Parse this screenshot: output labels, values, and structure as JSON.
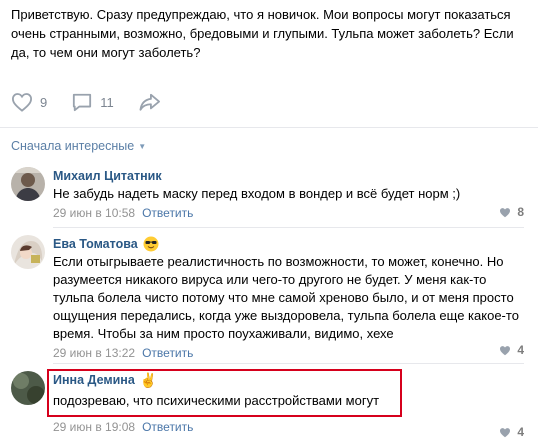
{
  "post": {
    "text": "Приветствую. Сразу предупреждаю, что я новичок. Мои вопросы могут показаться очень странными, возможно, бредовыми и глупыми. Тульпа может заболеть? Если да, то чем они могут заболеть?",
    "likes": "9",
    "comments": "11"
  },
  "sort_label": "Сначала интересные",
  "comments": [
    {
      "author": "Михаил Цитатник",
      "text": "Не забудь надеть маску перед входом в вондер и всё будет норм ;)",
      "date": "29 июн в 10:58",
      "reply": "Ответить",
      "likes": "8"
    },
    {
      "author": "Ева Томатова",
      "emoji": "smiling-face-with-sunglasses-icon",
      "text": "Если отыгрываете реалистичность по возможности, то может, конечно. Но разумеется никакого вируса или чего-то другого не будет. У меня как-то тульпа болела чисто потому что мне самой хреново было, и от меня просто ощущения передались, когда уже выздоровела, тульпа болела еще какое-то время. Чтобы за ним просто поухаживали, видимо, хехе",
      "date": "29 июн в 13:22",
      "reply": "Ответить",
      "likes": "4"
    },
    {
      "author": "Инна Демина",
      "emoji": "victory-hand-icon",
      "text": "подозреваю, что психическими расстройствами могут",
      "date": "29 июн в 19:08",
      "reply": "Ответить",
      "likes": "4"
    }
  ],
  "colors": {
    "link": "#2a5885",
    "meta": "#939393",
    "highlight": "#d6001c"
  }
}
